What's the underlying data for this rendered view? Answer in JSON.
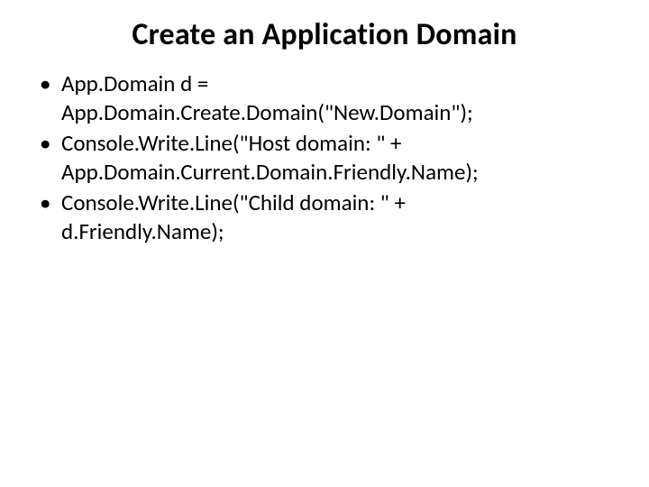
{
  "title": "Create an Application Domain",
  "bullets": [
    {
      "lines": [
        "App.Domain d =",
        "App.Domain.Create.Domain(\"New.Domain\");"
      ]
    },
    {
      "lines": [
        "Console.Write.Line(\"Host domain: \" +",
        "App.Domain.Current.Domain.Friendly.Name);"
      ]
    },
    {
      "lines": [
        "Console.Write.Line(\"Child domain: \" +",
        "d.Friendly.Name);"
      ]
    }
  ]
}
